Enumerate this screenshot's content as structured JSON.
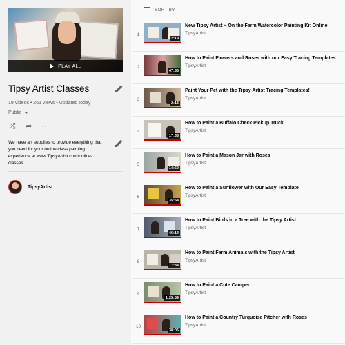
{
  "playlist": {
    "title": "Tipsy Artist Classes",
    "play_all": "PLAY ALL",
    "stats": "19 videos • 251 views • Updated today",
    "privacy": "Public",
    "description": "We have art supplies to provide everything that you need for your online class painting experience at www.TipsyArtist.com/online-classes",
    "owner": "TipsyArtist"
  },
  "sort": {
    "label": "SORT BY"
  },
  "videos": [
    {
      "index": "1",
      "title": "New Tipsy Artist ~ On the Farm Watercolor Painting Kit Online",
      "channel": "TipsyArtist",
      "duration": "2:19",
      "thumb": "#8fb0c8"
    },
    {
      "index": "2",
      "title": "How to Paint Flowers and Roses with our Easy Tracing Templates",
      "channel": "TipsyArtist",
      "duration": "47:33",
      "thumb": "#7a3b3b"
    },
    {
      "index": "3",
      "title": "Paint Your Pet with the Tipsy Artist Tracing Templates!",
      "channel": "TipsyArtist",
      "duration": "2:13",
      "thumb": "#6b5a4a"
    },
    {
      "index": "4",
      "title": "How to Paint a Buffalo Check Pickup Truck",
      "channel": "TipsyArtist",
      "duration": "17:33",
      "thumb": "#c9c2b8"
    },
    {
      "index": "5",
      "title": "How to Paint a Mason Jar with Roses",
      "channel": "TipsyArtist",
      "duration": "14:59",
      "thumb": "#9aa7a3"
    },
    {
      "index": "6",
      "title": "How to Paint a Sunflower with Our Easy Template",
      "channel": "TipsyArtist",
      "duration": "35:54",
      "thumb": "#5c4b3d"
    },
    {
      "index": "7",
      "title": "How to Paint Birds in a Tree with the Tipsy Artist",
      "channel": "TipsyArtist",
      "duration": "46:14",
      "thumb": "#4f5a6b"
    },
    {
      "index": "8",
      "title": "How to Paint Farm Animals with the Tipsy Artist",
      "channel": "TipsyArtist",
      "duration": "17:34",
      "thumb": "#b9b3a8"
    },
    {
      "index": "9",
      "title": "How to Paint a Cute Camper",
      "channel": "TipsyArtist",
      "duration": "1:25:59",
      "thumb": "#7b8b6f"
    },
    {
      "index": "10",
      "title": "How to Paint a Country Turquoise Pitcher with Roses",
      "channel": "TipsyArtist",
      "duration": "38:06",
      "thumb": "#b24646"
    }
  ],
  "colors": {
    "progress": "#cc0000",
    "sidebar_bg": "#f1f1f1",
    "page_bg": "#f9f9f9"
  },
  "icons": [
    "pencil-icon",
    "shuffle-icon",
    "share-icon",
    "more-icon",
    "sort-icon",
    "play-icon"
  ]
}
